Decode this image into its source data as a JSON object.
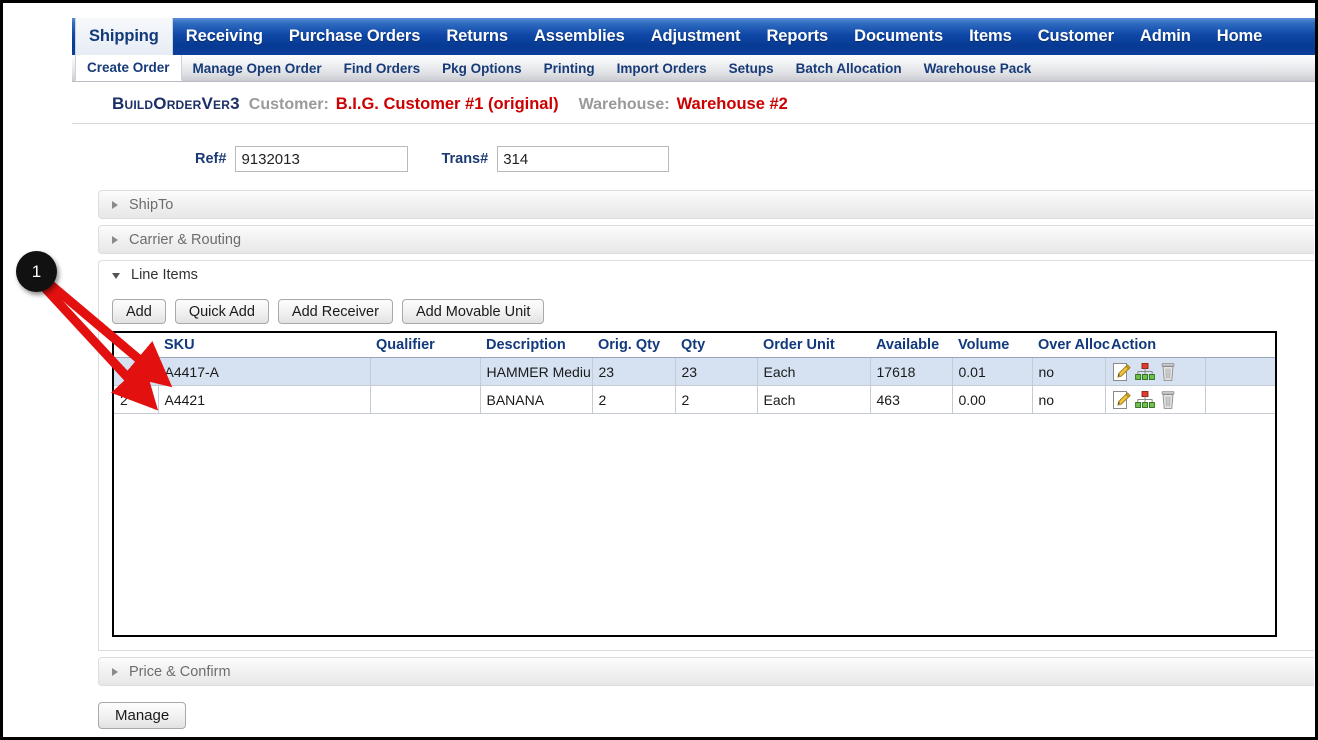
{
  "main_nav": [
    {
      "label": "Shipping",
      "active": true
    },
    {
      "label": "Receiving",
      "active": false
    },
    {
      "label": "Purchase Orders",
      "active": false
    },
    {
      "label": "Returns",
      "active": false
    },
    {
      "label": "Assemblies",
      "active": false
    },
    {
      "label": "Adjustment",
      "active": false
    },
    {
      "label": "Reports",
      "active": false
    },
    {
      "label": "Documents",
      "active": false
    },
    {
      "label": "Items",
      "active": false
    },
    {
      "label": "Customer",
      "active": false
    },
    {
      "label": "Admin",
      "active": false
    },
    {
      "label": "Home",
      "active": false
    }
  ],
  "sub_nav": [
    {
      "label": "Create Order",
      "active": true
    },
    {
      "label": "Manage Open Order",
      "active": false
    },
    {
      "label": "Find Orders",
      "active": false
    },
    {
      "label": "Pkg Options",
      "active": false
    },
    {
      "label": "Printing",
      "active": false
    },
    {
      "label": "Import Orders",
      "active": false
    },
    {
      "label": "Setups",
      "active": false
    },
    {
      "label": "Batch Allocation",
      "active": false
    },
    {
      "label": "Warehouse Pack",
      "active": false
    }
  ],
  "title_bar": {
    "app_title": "BuildOrderVer3",
    "customer_label": "Customer:",
    "customer_value": "B.I.G. Customer #1 (original)",
    "warehouse_label": "Warehouse:",
    "warehouse_value": "Warehouse #2"
  },
  "fields": {
    "ref_label": "Ref#",
    "ref_value": "9132013",
    "ref_placeholder": "",
    "trans_label": "Trans#",
    "trans_value": "314",
    "trans_placeholder": ""
  },
  "sections": {
    "shipto": "ShipTo",
    "carrier": "Carrier & Routing",
    "line_items": "Line Items",
    "price_confirm": "Price & Confirm"
  },
  "line_item_buttons": [
    {
      "label": "Add"
    },
    {
      "label": "Quick Add"
    },
    {
      "label": "Add Receiver"
    },
    {
      "label": "Add Movable Unit"
    }
  ],
  "grid": {
    "columns": [
      "",
      "SKU",
      "Qualifier",
      "Description",
      "Orig. Qty",
      "Qty",
      "Order Unit",
      "Available",
      "Volume",
      "Over Alloc",
      "Action",
      ""
    ],
    "rows": [
      {
        "index": "1",
        "sku": "A4417-A",
        "qualifier": "",
        "description": "HAMMER Mediu...",
        "orig_qty": "23",
        "qty": "23",
        "order_unit": "Each",
        "available": "17618",
        "volume": "0.01",
        "over_alloc": "no",
        "selected": true
      },
      {
        "index": "2",
        "sku": "A4421",
        "qualifier": "",
        "description": "BANANA",
        "orig_qty": "2",
        "qty": "2",
        "order_unit": "Each",
        "available": "463",
        "volume": "0.00",
        "over_alloc": "no",
        "selected": false
      }
    ],
    "row_action_icons": [
      "edit-icon",
      "allocation-tree-icon",
      "delete-icon"
    ]
  },
  "footer": {
    "manage_label": "Manage"
  },
  "annotation": {
    "badge_number": "1",
    "arrow_color": "#e31010"
  },
  "colors": {
    "nav_blue": "#0f47a8",
    "accent_red": "#cc0000",
    "label_navy": "#1b3a74",
    "selected_row": "#d6e2f2"
  }
}
